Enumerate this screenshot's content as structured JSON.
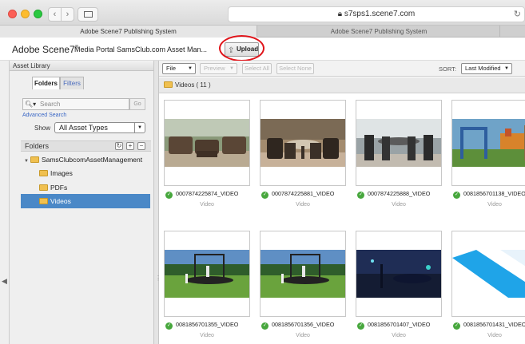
{
  "browser": {
    "url": "s7sps1.scene7.com",
    "tabs": [
      "Adobe Scene7 Publishing System",
      "Adobe Scene7 Publishing System"
    ]
  },
  "header": {
    "brand": "Adobe Scene7",
    "brand_mark": "®",
    "portal": "Media Portal",
    "account": "SamsClub.com Asset Man...",
    "upload_label": "Upload"
  },
  "asset_library": {
    "title": "Asset Library",
    "tabs": [
      "Folders",
      "Filters"
    ],
    "search_placeholder": "Search",
    "go_label": "Go",
    "advanced_search": "Advanced Search",
    "show_label": "Show",
    "show_value": "All Asset Types",
    "folders_title": "Folders",
    "tree": {
      "root": "SamsClubcomAssetManagement",
      "children": [
        "Images",
        "PDFs",
        "Videos"
      ],
      "selected": "Videos"
    }
  },
  "toolbar": {
    "file": "File",
    "preview": "Preview",
    "select_all": "Select All",
    "select_none": "Select None",
    "sort_label": "SORT:",
    "sort_value": "Last Modified"
  },
  "path": "Videos ( 11 )",
  "assets": [
    {
      "name": "0007874225874_VIDEO",
      "type": "Video",
      "scene": "patio-wicker"
    },
    {
      "name": "0007874225881_VIDEO",
      "type": "Video",
      "scene": "patio-table"
    },
    {
      "name": "0007874225888_VIDEO",
      "type": "Video",
      "scene": "patio-bar"
    },
    {
      "name": "0081856701138_VIDEO",
      "type": "Video",
      "scene": "playset"
    },
    {
      "name": "0081856701355_VIDEO",
      "type": "Video",
      "scene": "trampoline"
    },
    {
      "name": "0081856701356_VIDEO",
      "type": "Video",
      "scene": "trampoline"
    },
    {
      "name": "0081856701407_VIDEO",
      "type": "Video",
      "scene": "night"
    },
    {
      "name": "0081856701431_VIDEO",
      "type": "Video",
      "scene": "blue-graphic"
    }
  ],
  "colors": {
    "selected_folder": "#4a88c7",
    "status_ok": "#47a73d",
    "annotation": "#e0141a"
  }
}
